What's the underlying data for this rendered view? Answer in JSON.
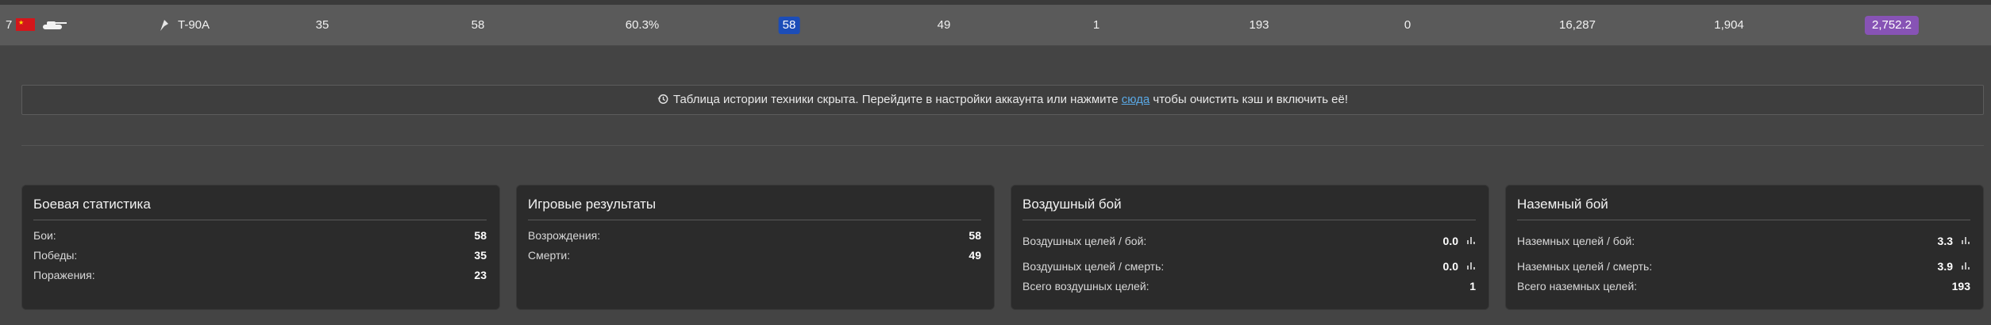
{
  "vehicle_row": {
    "rank": "7",
    "flag_icon": "ussr-flag-icon",
    "vehicle_type_icon": "tank-silhouette-icon",
    "class_icon": "light-tank-class-icon",
    "name": "T-90A",
    "c1": "35",
    "c2": "58",
    "c3": "60.3%",
    "c4": "58",
    "c5": "49",
    "c6": "1",
    "c7": "193",
    "c8": "0",
    "c9": "16,287",
    "c10": "1,904",
    "c11": "2,752.2"
  },
  "notice": {
    "icon": "history-icon",
    "text_before": "Таблица истории техники скрыта. Перейдите в настройки аккаунта или нажмите ",
    "link_text": "сюда",
    "text_after": " чтобы очистить кэш и включить её!"
  },
  "cards": {
    "battle": {
      "title": "Боевая статистика",
      "rows": [
        {
          "label": "Бои:",
          "value": "58"
        },
        {
          "label": "Победы:",
          "value": "35"
        },
        {
          "label": "Поражения:",
          "value": "23"
        }
      ]
    },
    "game": {
      "title": "Игровые результаты",
      "rows": [
        {
          "label": "Возрождения:",
          "value": "58"
        },
        {
          "label": "Смерти:",
          "value": "49"
        }
      ]
    },
    "air": {
      "title": "Воздушный бой",
      "rows": [
        {
          "label": "Воздушных целей / бой:",
          "value": "0.0"
        },
        {
          "label": "Воздушных целей / смерть:",
          "value": "0.0"
        },
        {
          "label": "Всего воздушных целей:",
          "value": "1"
        }
      ]
    },
    "ground": {
      "title": "Наземный бой",
      "rows": [
        {
          "label": "Наземных целей / бой:",
          "value": "3.3"
        },
        {
          "label": "Наземных целей / смерть:",
          "value": "3.9"
        },
        {
          "label": "Всего наземных целей:",
          "value": "193"
        }
      ]
    }
  },
  "colors": {
    "background": "#444444",
    "row": "#5a5a5a",
    "card": "#2b2b2b",
    "highlight_blue": "#1c4db8",
    "highlight_purple": "#8753b5",
    "link": "#5aa9e6"
  }
}
